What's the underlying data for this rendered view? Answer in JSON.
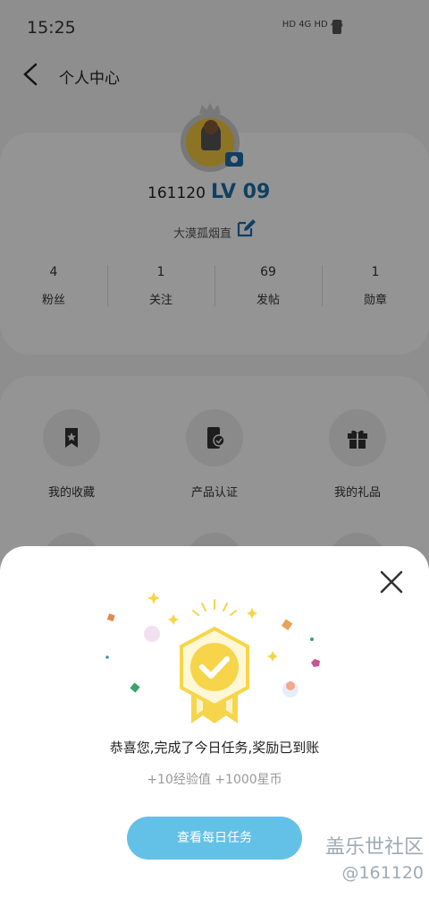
{
  "status_bar": {
    "time": "15:25",
    "network": "HD 4G HD 4G"
  },
  "header": {
    "title": "个人中心"
  },
  "profile": {
    "user_id": "161120",
    "level": "LV 09",
    "nickname": "大漠孤烟直",
    "stats": [
      {
        "value": "4",
        "label": "粉丝"
      },
      {
        "value": "1",
        "label": "关注"
      },
      {
        "value": "69",
        "label": "发帖"
      },
      {
        "value": "1",
        "label": "勋章"
      }
    ]
  },
  "menu": {
    "items": [
      {
        "label": "我的收藏",
        "icon": "bookmark-star-icon"
      },
      {
        "label": "产品认证",
        "icon": "phone-check-icon"
      },
      {
        "label": "我的礼品",
        "icon": "gift-icon"
      }
    ]
  },
  "dialog": {
    "message": "恭喜您,完成了今日任务,奖励已到账",
    "reward": "+10经验值 +1000星币",
    "button_label": "查看每日任务"
  },
  "watermark": {
    "title": "盖乐世社区",
    "handle": "@161120"
  },
  "colors": {
    "accent": "#1c6fa8",
    "button": "#63c1e8",
    "medal": "#f7d54a"
  }
}
